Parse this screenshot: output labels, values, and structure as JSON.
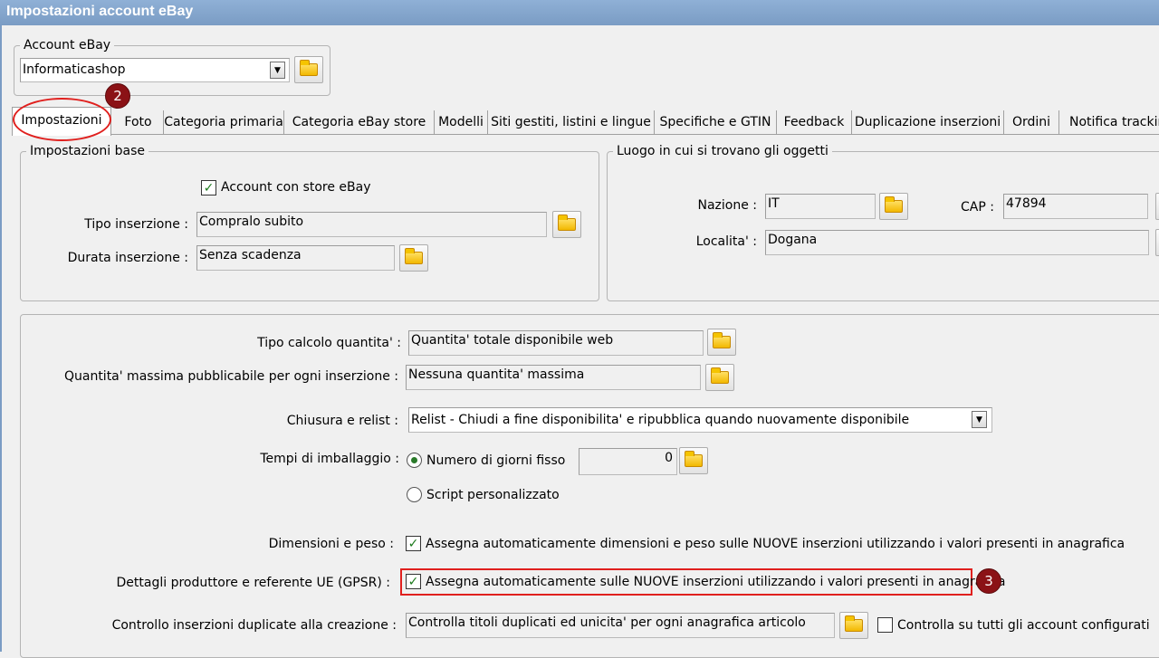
{
  "window": {
    "title": "Impostazioni account eBay"
  },
  "account": {
    "legend": "Account eBay",
    "selected": "Informaticashop"
  },
  "annotations": {
    "badge2": "2",
    "badge3": "3"
  },
  "tabs": [
    "Impostazioni",
    "Foto",
    "Categoria primaria",
    "Categoria eBay store",
    "Modelli",
    "Siti gestiti, listini e lingue",
    "Specifiche e GTIN",
    "Feedback",
    "Duplicazione inserzioni",
    "Ordini",
    "Notifica tracking"
  ],
  "base": {
    "legend": "Impostazioni base",
    "store_checkbox_label": "Account con store eBay",
    "store_checked": true,
    "tipo_label": "Tipo inserzione :",
    "tipo_value": "Compralo subito",
    "durata_label": "Durata inserzione :",
    "durata_value": "Senza scadenza"
  },
  "luogo": {
    "legend": "Luogo in cui si trovano gli oggetti",
    "nazione_label": "Nazione :",
    "nazione_value": "IT",
    "cap_label": "CAP :",
    "cap_value": "47894",
    "localita_label": "Localita' :",
    "localita_value": "Dogana"
  },
  "settings": {
    "calcolo_label": "Tipo calcolo quantita' :",
    "calcolo_value": "Quantita' totale disponibile web",
    "massima_label": "Quantita' massima pubblicabile per ogni inserzione :",
    "massima_value": "Nessuna quantita' massima",
    "chiusura_label": "Chiusura e relist :",
    "chiusura_value": "Relist - Chiudi a fine disponibilita' e ripubblica quando nuovamente disponibile",
    "tempi_label": "Tempi di imballaggio :",
    "radio_fisso": "Numero di giorni fisso",
    "giorni_value": "0",
    "radio_script": "Script personalizzato",
    "dimensioni_label": "Dimensioni e peso :",
    "dimensioni_check": "Assegna automaticamente dimensioni e peso sulle NUOVE inserzioni utilizzando i valori presenti in anagrafica",
    "gpsr_label": "Dettagli produttore e referente UE (GPSR) :",
    "gpsr_check": "Assegna automaticamente sulle NUOVE inserzioni utilizzando i valori presenti in anagrafica",
    "duplicate_label": "Controllo inserzioni duplicate alla creazione :",
    "duplicate_value": "Controlla titoli duplicati ed unicita' per ogni anagrafica articolo",
    "all_accounts_check": "Controlla su tutti gli account configurati"
  },
  "colors": {
    "titlebar": "#7a9cc4",
    "annotation": "#e0201e",
    "badge": "#8b1216"
  }
}
